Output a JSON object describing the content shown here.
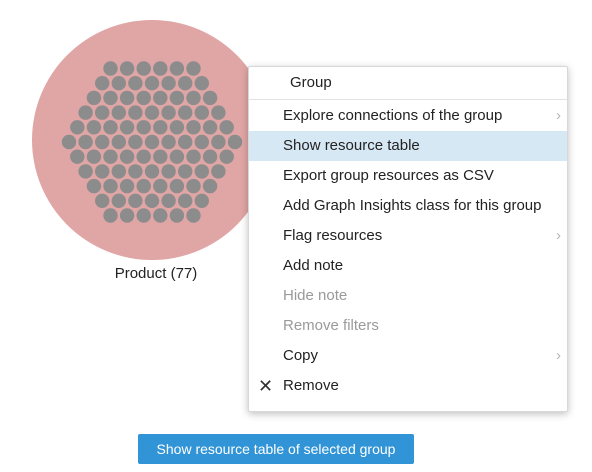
{
  "group_node": {
    "label": "Product (77)",
    "fill_color": "#e0a6a6",
    "dot_color": "#8c8c8c",
    "dot_rows": [
      6,
      7,
      8,
      9,
      10,
      11,
      10,
      9,
      8,
      7,
      6
    ]
  },
  "context_menu": {
    "header": "Group",
    "items": [
      {
        "label": "Explore connections of the group",
        "submenu": true,
        "state": "normal"
      },
      {
        "label": "Show resource table",
        "submenu": false,
        "state": "highlighted"
      },
      {
        "label": "Export group resources as CSV",
        "submenu": false,
        "state": "normal"
      },
      {
        "label": "Add Graph Insights class for this group",
        "submenu": false,
        "state": "normal"
      },
      {
        "label": "Flag resources",
        "submenu": true,
        "state": "normal"
      },
      {
        "label": "Add note",
        "submenu": false,
        "state": "normal"
      },
      {
        "label": "Hide note",
        "submenu": false,
        "state": "disabled"
      },
      {
        "label": "Remove filters",
        "submenu": false,
        "state": "disabled"
      },
      {
        "label": "Copy",
        "submenu": true,
        "state": "normal"
      },
      {
        "label": "Remove",
        "submenu": false,
        "state": "normal",
        "icon": "close-icon"
      }
    ],
    "highlight_color": "#d7e8f5"
  },
  "bottom_button": {
    "label": "Show resource table of selected group",
    "color": "#3194d6"
  }
}
